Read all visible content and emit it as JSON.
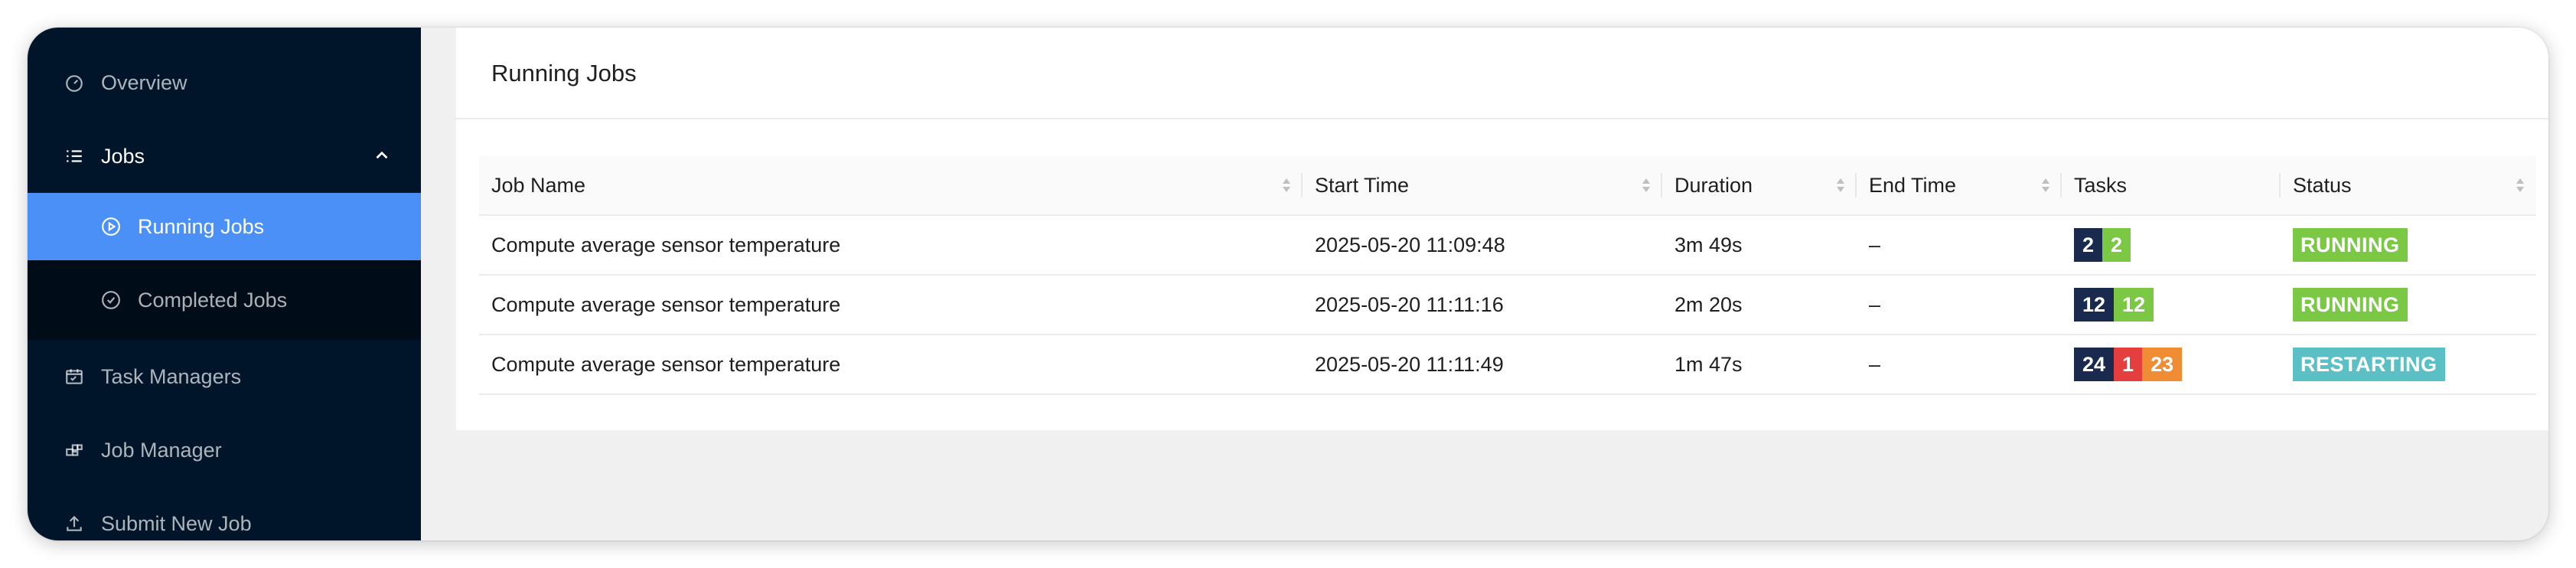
{
  "sidebar": {
    "items": [
      {
        "label": "Overview",
        "icon": "dashboard-icon"
      },
      {
        "label": "Jobs",
        "icon": "list-icon",
        "expanded": true,
        "children": [
          {
            "label": "Running Jobs",
            "icon": "play-circle-icon",
            "active": true
          },
          {
            "label": "Completed Jobs",
            "icon": "check-circle-icon"
          }
        ]
      },
      {
        "label": "Task Managers",
        "icon": "schedule-icon"
      },
      {
        "label": "Job Manager",
        "icon": "cluster-icon"
      },
      {
        "label": "Submit New Job",
        "icon": "upload-icon"
      }
    ]
  },
  "main": {
    "title": "Running Jobs",
    "table": {
      "columns": [
        "Job Name",
        "Start Time",
        "Duration",
        "End Time",
        "Tasks",
        "Status"
      ],
      "rows": [
        {
          "name": "Compute average sensor temperature",
          "start": "2025-05-20 11:09:48",
          "duration": "3m 49s",
          "end": "–",
          "tasks": [
            {
              "value": "2",
              "color": "#192a4e"
            },
            {
              "value": "2",
              "color": "#7bc844"
            }
          ],
          "status": "RUNNING",
          "status_color": "#7bc844"
        },
        {
          "name": "Compute average sensor temperature",
          "start": "2025-05-20 11:11:16",
          "duration": "2m 20s",
          "end": "–",
          "tasks": [
            {
              "value": "12",
              "color": "#192a4e"
            },
            {
              "value": "12",
              "color": "#7bc844"
            }
          ],
          "status": "RUNNING",
          "status_color": "#7bc844"
        },
        {
          "name": "Compute average sensor temperature",
          "start": "2025-05-20 11:11:49",
          "duration": "1m 47s",
          "end": "–",
          "tasks": [
            {
              "value": "24",
              "color": "#192a4e"
            },
            {
              "value": "1",
              "color": "#e53e3e"
            },
            {
              "value": "23",
              "color": "#f08c33"
            }
          ],
          "status": "RESTARTING",
          "status_color": "#5bc0c6"
        }
      ]
    }
  }
}
